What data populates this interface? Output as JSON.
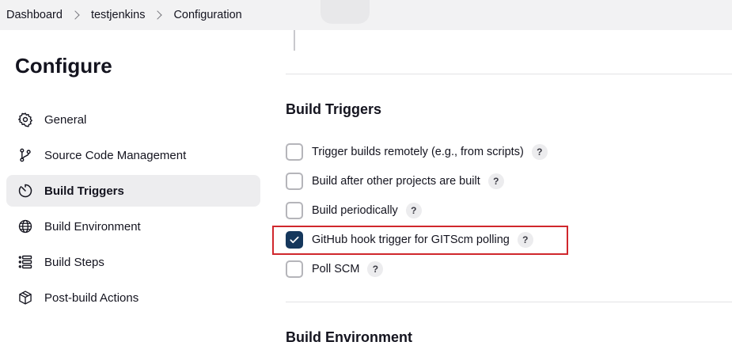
{
  "breadcrumb": {
    "items": [
      "Dashboard",
      "testjenkins",
      "Configuration"
    ]
  },
  "page": {
    "title": "Configure"
  },
  "sidebar": {
    "items": [
      {
        "label": "General",
        "icon": "gear-icon",
        "active": false
      },
      {
        "label": "Source Code Management",
        "icon": "branch-icon",
        "active": false
      },
      {
        "label": "Build Triggers",
        "icon": "timer-icon",
        "active": true
      },
      {
        "label": "Build Environment",
        "icon": "globe-icon",
        "active": false
      },
      {
        "label": "Build Steps",
        "icon": "list-icon",
        "active": false
      },
      {
        "label": "Post-build Actions",
        "icon": "package-icon",
        "active": false
      }
    ]
  },
  "build_triggers": {
    "title": "Build Triggers",
    "options": [
      {
        "label": "Trigger builds remotely (e.g., from scripts)",
        "checked": false,
        "help": "?"
      },
      {
        "label": "Build after other projects are built",
        "checked": false,
        "help": "?"
      },
      {
        "label": "Build periodically",
        "checked": false,
        "help": "?"
      },
      {
        "label": "GitHub hook trigger for GITScm polling",
        "checked": true,
        "help": "?",
        "highlighted": true
      },
      {
        "label": "Poll SCM",
        "checked": false,
        "help": "?"
      }
    ]
  },
  "build_environment": {
    "title": "Build Environment"
  },
  "colors": {
    "checkbox_checked": "#15375c",
    "highlight_border": "#d0272d",
    "active_nav_bg": "#ededef"
  }
}
